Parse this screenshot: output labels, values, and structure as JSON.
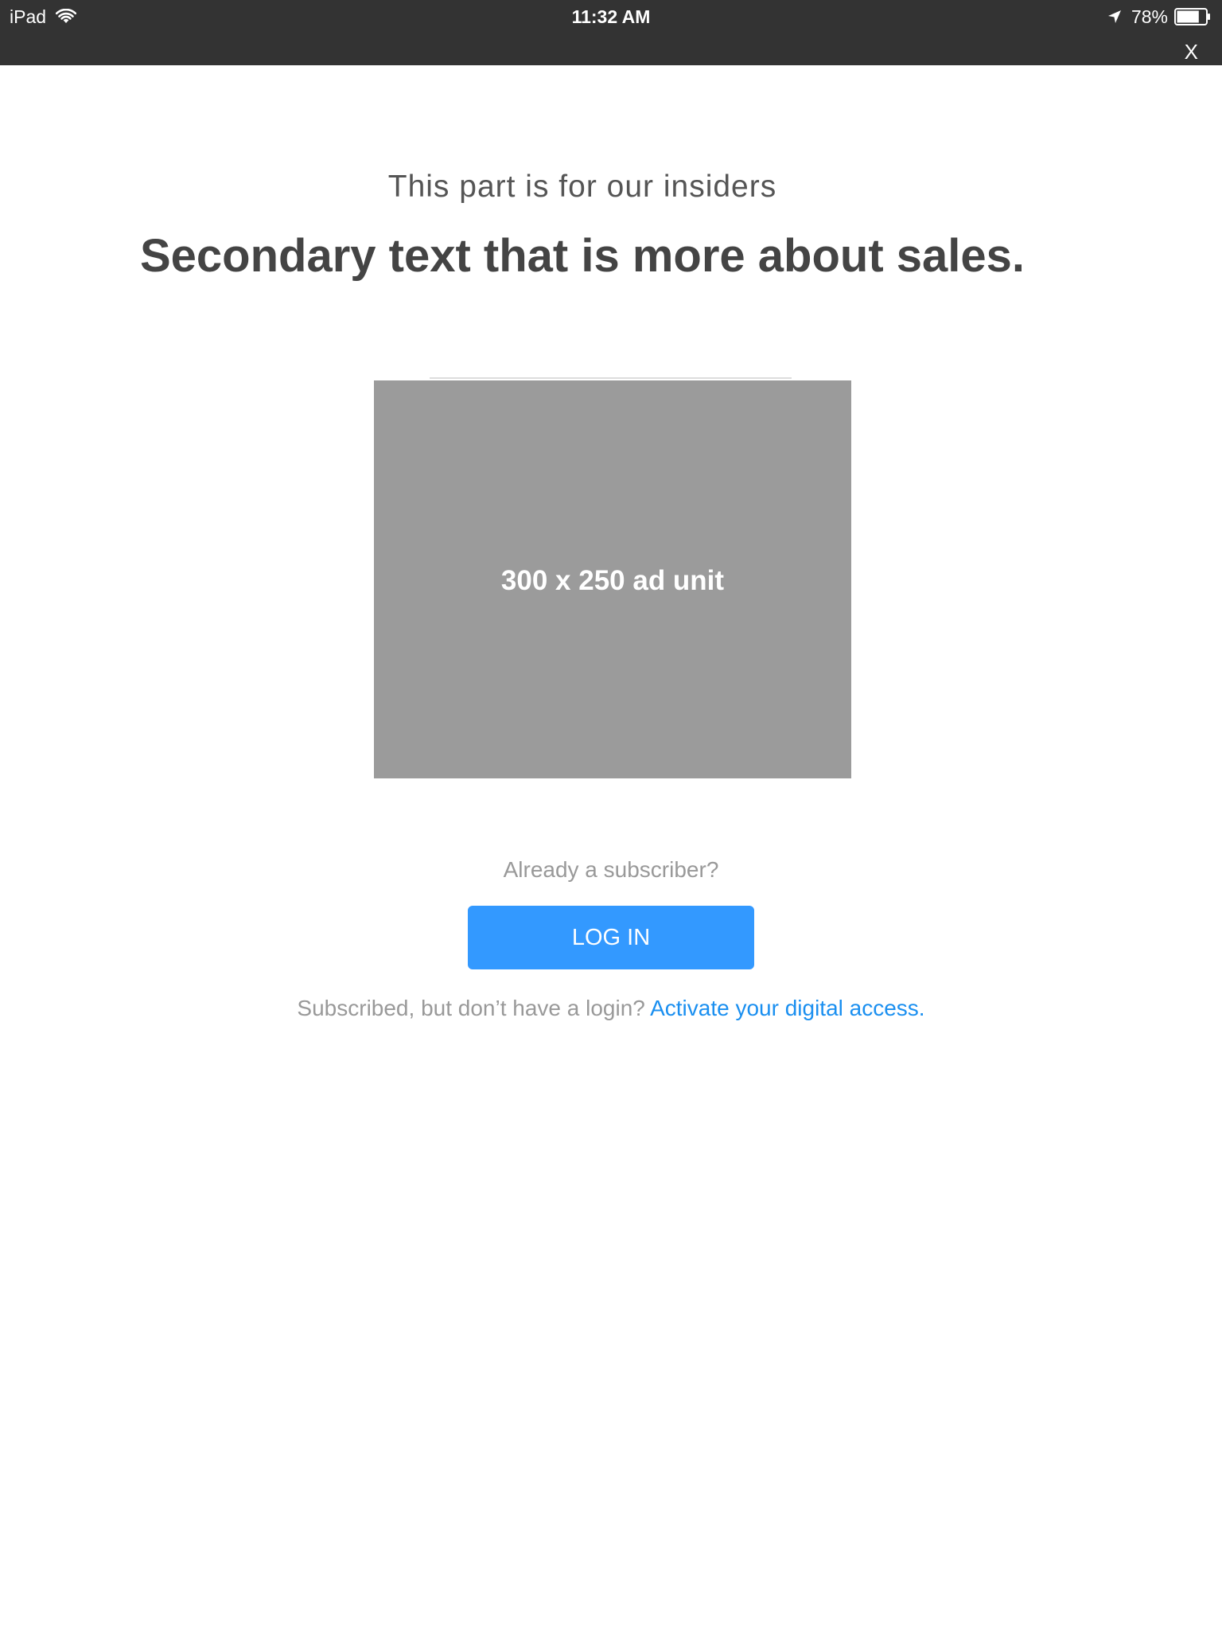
{
  "status_bar": {
    "device": "iPad",
    "time": "11:32 AM",
    "battery": "78%",
    "battery_level": 0.78,
    "icons": [
      "wifi-icon",
      "location-arrow-icon",
      "battery-icon"
    ]
  },
  "close": {
    "label": "X"
  },
  "header": {
    "subtitle": "This part is for our insiders",
    "headline": "Secondary text that is more about sales."
  },
  "ad": {
    "label": "300 x 250 ad unit"
  },
  "login": {
    "prompt": "Already a subscriber?",
    "button_label": "LOG IN",
    "activate_text": "Subscribed, but don’t have a login?",
    "activate_link": "Activate your digital access."
  },
  "colors": {
    "status_bar": "#333333",
    "button": "#3399ff",
    "link": "#1a8ff0",
    "ad_background": "#9b9b9b"
  }
}
